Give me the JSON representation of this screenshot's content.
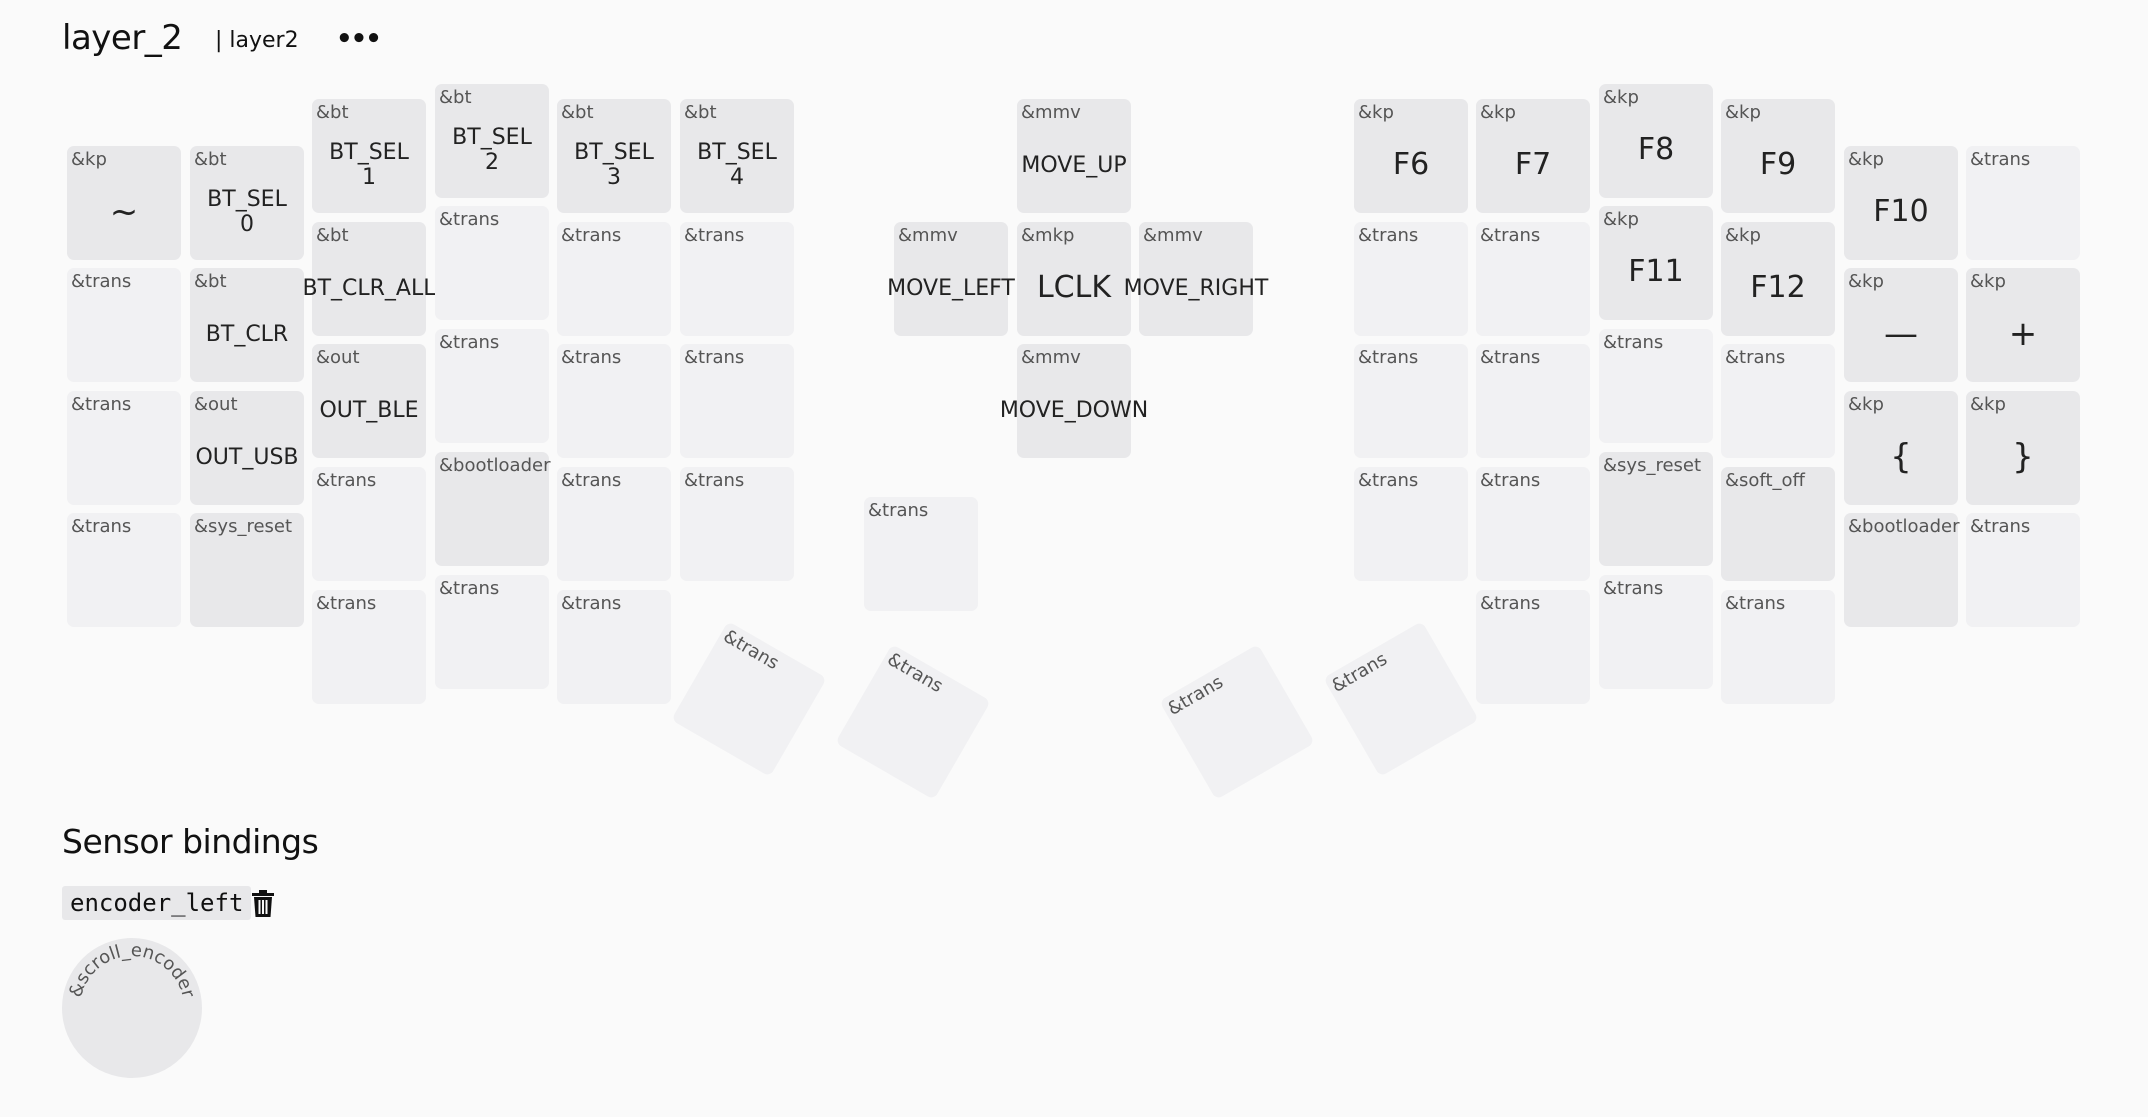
{
  "header": {
    "layer_name": "layer_2",
    "layer_label": "| layer2",
    "menu_label": "•••"
  },
  "keys": [
    {
      "id": "k1",
      "b": "&kp",
      "p": "~",
      "cls": "symbol"
    },
    {
      "id": "k2",
      "b": "&bt",
      "p": "BT_SEL\n0"
    },
    {
      "id": "k3",
      "b": "&bt",
      "p": "BT_SEL\n1"
    },
    {
      "id": "k4",
      "b": "&bt",
      "p": "BT_SEL\n2"
    },
    {
      "id": "k5",
      "b": "&bt",
      "p": "BT_SEL\n3"
    },
    {
      "id": "k6",
      "b": "&bt",
      "p": "BT_SEL\n4"
    },
    {
      "id": "k7",
      "b": "&mmv",
      "p": "MOVE_UP"
    },
    {
      "id": "k8",
      "b": "&kp",
      "p": "F6",
      "cls": "big"
    },
    {
      "id": "k9",
      "b": "&kp",
      "p": "F7",
      "cls": "big"
    },
    {
      "id": "k10",
      "b": "&kp",
      "p": "F8",
      "cls": "big"
    },
    {
      "id": "k11",
      "b": "&kp",
      "p": "F9",
      "cls": "big"
    },
    {
      "id": "k12",
      "b": "&kp",
      "p": "F10",
      "cls": "big"
    },
    {
      "id": "k13",
      "b": "&trans",
      "p": ""
    },
    {
      "id": "k14",
      "b": "&trans",
      "p": ""
    },
    {
      "id": "k15",
      "b": "&bt",
      "p": "BT_CLR"
    },
    {
      "id": "k16",
      "b": "&bt",
      "p": "BT_CLR_ALL"
    },
    {
      "id": "k17",
      "b": "&trans",
      "p": ""
    },
    {
      "id": "k18",
      "b": "&trans",
      "p": ""
    },
    {
      "id": "k19",
      "b": "&trans",
      "p": ""
    },
    {
      "id": "k20",
      "b": "&mmv",
      "p": "MOVE_LEFT"
    },
    {
      "id": "k21",
      "b": "&mkp",
      "p": "LCLK",
      "cls": "big"
    },
    {
      "id": "k22",
      "b": "&mmv",
      "p": "MOVE_RIGHT"
    },
    {
      "id": "k23",
      "b": "&trans",
      "p": ""
    },
    {
      "id": "k24",
      "b": "&trans",
      "p": ""
    },
    {
      "id": "k25",
      "b": "&kp",
      "p": "F11",
      "cls": "big"
    },
    {
      "id": "k26",
      "b": "&kp",
      "p": "F12",
      "cls": "big"
    },
    {
      "id": "k27",
      "b": "&kp",
      "p": "—",
      "cls": "symbol"
    },
    {
      "id": "k28",
      "b": "&kp",
      "p": "+",
      "cls": "symbol"
    },
    {
      "id": "k29",
      "b": "&trans",
      "p": ""
    },
    {
      "id": "k30",
      "b": "&out",
      "p": "OUT_USB"
    },
    {
      "id": "k31",
      "b": "&out",
      "p": "OUT_BLE"
    },
    {
      "id": "k32",
      "b": "&trans",
      "p": ""
    },
    {
      "id": "k33",
      "b": "&trans",
      "p": ""
    },
    {
      "id": "k34",
      "b": "&trans",
      "p": ""
    },
    {
      "id": "k35",
      "b": "&mmv",
      "p": "MOVE_DOWN"
    },
    {
      "id": "k36",
      "b": "&trans",
      "p": ""
    },
    {
      "id": "k37",
      "b": "&trans",
      "p": ""
    },
    {
      "id": "k38",
      "b": "&trans",
      "p": ""
    },
    {
      "id": "k39",
      "b": "&trans",
      "p": ""
    },
    {
      "id": "k40",
      "b": "&kp",
      "p": "{",
      "cls": "symbol"
    },
    {
      "id": "k41",
      "b": "&kp",
      "p": "}",
      "cls": "symbol"
    },
    {
      "id": "k42",
      "b": "&trans",
      "p": ""
    },
    {
      "id": "k43",
      "b": "&sys_reset",
      "p": ""
    },
    {
      "id": "k44",
      "b": "&trans",
      "p": ""
    },
    {
      "id": "k45",
      "b": "&bootloader",
      "p": ""
    },
    {
      "id": "k46",
      "b": "&trans",
      "p": ""
    },
    {
      "id": "k47",
      "b": "&trans",
      "p": ""
    },
    {
      "id": "k48",
      "b": "&trans",
      "p": ""
    },
    {
      "id": "k49",
      "b": "&trans",
      "p": ""
    },
    {
      "id": "k50",
      "b": "&trans",
      "p": ""
    },
    {
      "id": "k51",
      "b": "&sys_reset",
      "p": ""
    },
    {
      "id": "k52",
      "b": "&soft_off",
      "p": ""
    },
    {
      "id": "k53",
      "b": "&bootloader",
      "p": ""
    },
    {
      "id": "k54",
      "b": "&trans",
      "p": ""
    },
    {
      "id": "k55",
      "b": "&trans",
      "p": ""
    },
    {
      "id": "k56",
      "b": "&trans",
      "p": ""
    },
    {
      "id": "k57",
      "b": "&trans",
      "p": ""
    },
    {
      "id": "k58",
      "b": "&trans",
      "p": ""
    },
    {
      "id": "k59",
      "b": "&trans",
      "p": ""
    },
    {
      "id": "k60",
      "b": "&trans",
      "p": ""
    },
    {
      "id": "k61",
      "b": "&trans",
      "p": ""
    },
    {
      "id": "k62",
      "b": "&trans",
      "p": ""
    },
    {
      "id": "k63",
      "b": "&trans",
      "p": ""
    },
    {
      "id": "k64",
      "b": "&trans",
      "p": ""
    }
  ],
  "sensors": {
    "heading": "Sensor bindings",
    "name": "encoder_left",
    "delete_icon": "trash-icon",
    "binding": "&scroll_encoder"
  }
}
